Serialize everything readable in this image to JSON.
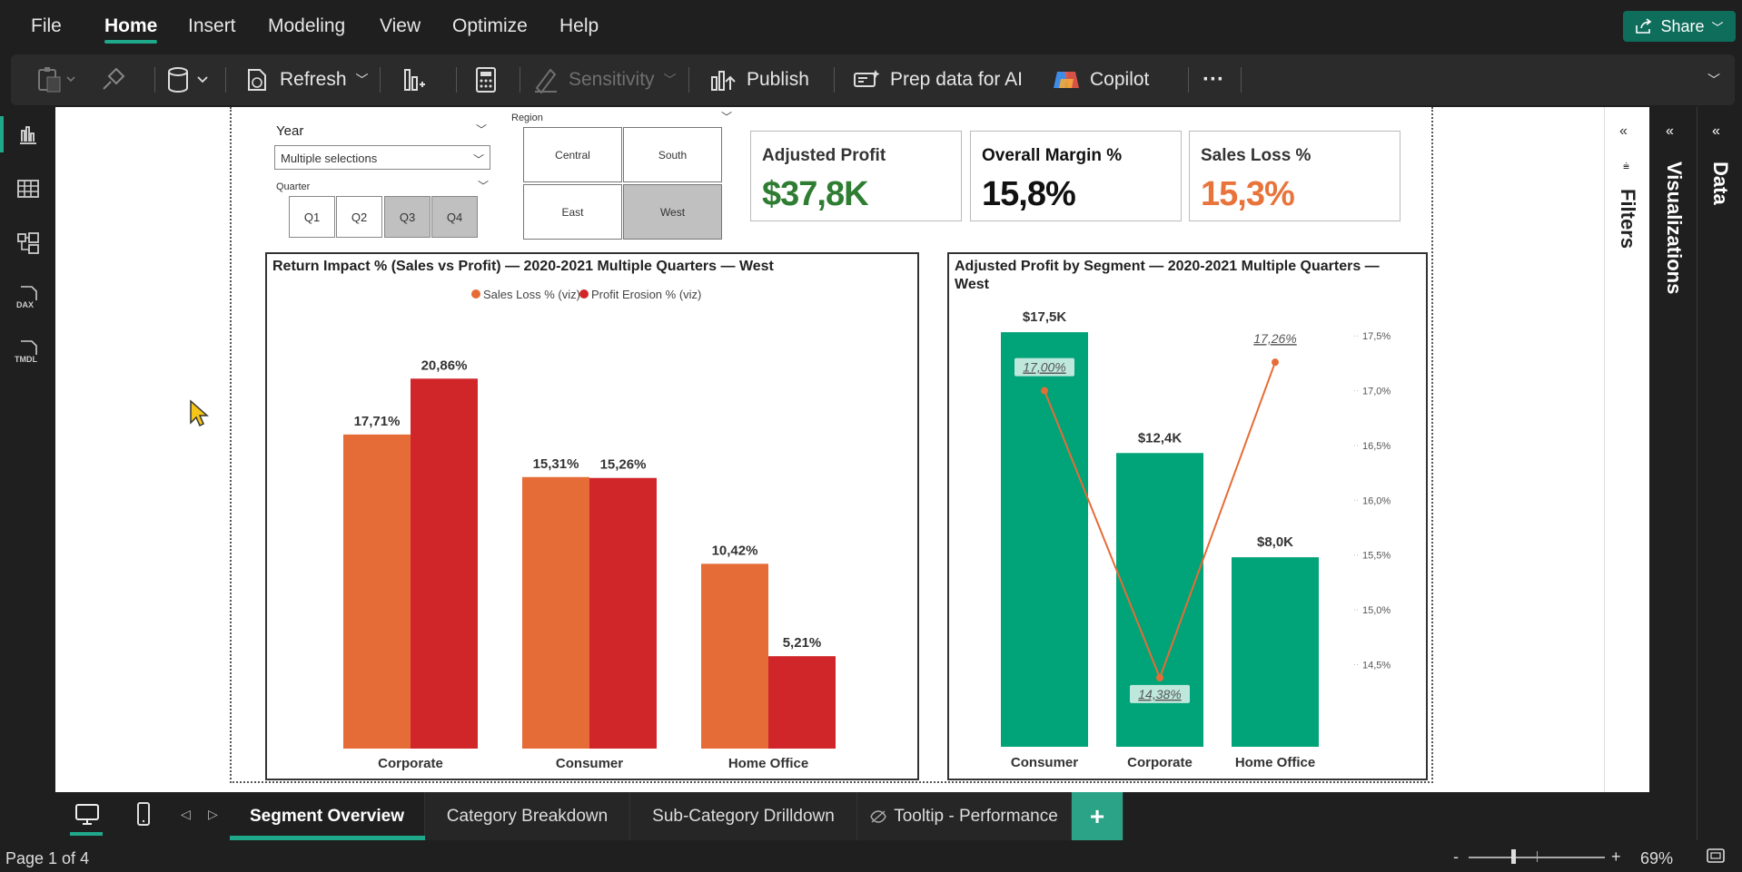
{
  "menu": {
    "items": [
      "File",
      "Home",
      "Insert",
      "Modeling",
      "View",
      "Optimize",
      "Help"
    ],
    "share_label": "Share"
  },
  "ribbon": {
    "refresh": "Refresh",
    "sensitivity": "Sensitivity",
    "publish": "Publish",
    "prep": "Prep data for AI",
    "copilot": "Copilot",
    "more": "···"
  },
  "slicers": {
    "year_title": "Year",
    "year_value": "Multiple selections",
    "quarter_title": "Quarter",
    "quarters": [
      {
        "label": "Q1",
        "selected": false
      },
      {
        "label": "Q2",
        "selected": false
      },
      {
        "label": "Q3",
        "selected": true
      },
      {
        "label": "Q4",
        "selected": true
      }
    ],
    "region_title": "Region",
    "regions": [
      {
        "label": "Central",
        "selected": false
      },
      {
        "label": "South",
        "selected": false
      },
      {
        "label": "East",
        "selected": false
      },
      {
        "label": "West",
        "selected": true
      }
    ]
  },
  "cards": [
    {
      "title": "Adjusted Profit",
      "value": "$37,8K",
      "color": "#2e7d32"
    },
    {
      "title": "Overall Margin %",
      "value": "15,8%",
      "color": "#111111"
    },
    {
      "title": "Sales Loss %",
      "value": "15,3%",
      "color": "#e8743b"
    }
  ],
  "chart_data": [
    {
      "type": "bar",
      "title": "Return Impact % (Sales vs Profit) — 2020-2021 Multiple Quarters — West",
      "categories": [
        "Corporate",
        "Consumer",
        "Home Office"
      ],
      "series": [
        {
          "name": "Sales Loss % (viz)",
          "color": "#e66c37",
          "values": [
            17.71,
            15.31,
            10.42
          ],
          "labels": [
            "17,71%",
            "15,31%",
            "10,42%"
          ]
        },
        {
          "name": "Profit Erosion % (viz)",
          "color": "#d0262a",
          "values": [
            20.86,
            15.26,
            5.21
          ],
          "labels": [
            "20,86%",
            "15,26%",
            "5,21%"
          ]
        }
      ],
      "ylim": [
        0,
        22
      ]
    },
    {
      "type": "bar+line",
      "title": "Adjusted Profit by Segment — 2020-2021 Multiple Quarters — West",
      "categories": [
        "Consumer",
        "Corporate",
        "Home Office"
      ],
      "bars": {
        "values": [
          17.5,
          12.4,
          8.0
        ],
        "labels": [
          "$17,5K",
          "$12,4K",
          "$8,0K"
        ],
        "color": "#01a378",
        "ylim": [
          0,
          18.5
        ]
      },
      "line": {
        "values": [
          17.0,
          14.38,
          17.26
        ],
        "labels": [
          "17,00%",
          "14,38%",
          "17,26%"
        ],
        "color": "#e66c37",
        "ylim": [
          13.75,
          17.75
        ]
      },
      "y2_ticks": [
        "17,5%",
        "17,0%",
        "16,5%",
        "16,0%",
        "15,5%",
        "15,0%",
        "14,5%"
      ],
      "y2_tick_values": [
        17.5,
        17.0,
        16.5,
        16.0,
        15.5,
        15.0,
        14.5
      ]
    }
  ],
  "panes": {
    "filters": "Filters",
    "visualizations": "Visualizations",
    "data": "Data"
  },
  "tabs": [
    "Segment Overview",
    "Category Breakdown",
    "Sub-Category Drilldown",
    "Tooltip - Performance"
  ],
  "add_tab": "+",
  "status": {
    "page": "Page 1 of 4",
    "zoom": "69%",
    "minus": "-",
    "plus": "+"
  }
}
